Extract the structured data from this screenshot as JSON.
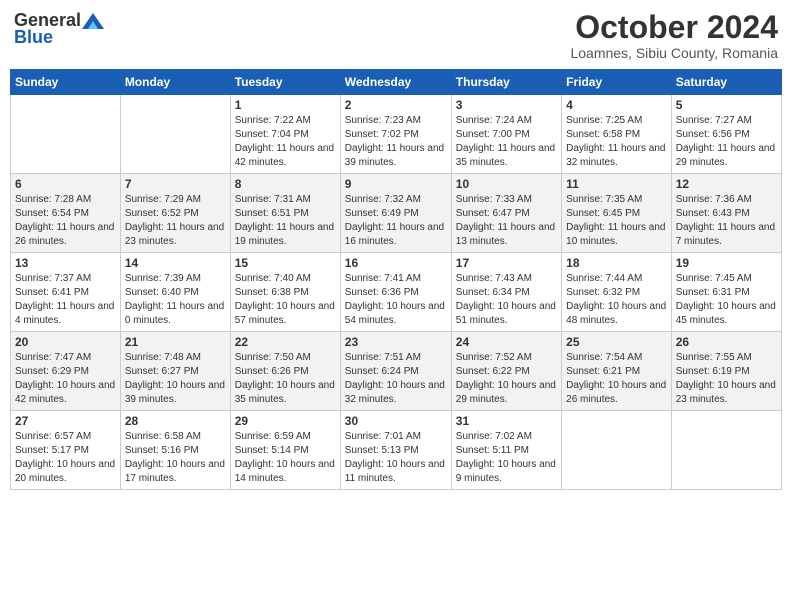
{
  "header": {
    "logo_general": "General",
    "logo_blue": "Blue",
    "month": "October 2024",
    "location": "Loamnes, Sibiu County, Romania"
  },
  "days_of_week": [
    "Sunday",
    "Monday",
    "Tuesday",
    "Wednesday",
    "Thursday",
    "Friday",
    "Saturday"
  ],
  "weeks": [
    [
      {
        "day": "",
        "detail": ""
      },
      {
        "day": "",
        "detail": ""
      },
      {
        "day": "1",
        "detail": "Sunrise: 7:22 AM\nSunset: 7:04 PM\nDaylight: 11 hours and 42 minutes."
      },
      {
        "day": "2",
        "detail": "Sunrise: 7:23 AM\nSunset: 7:02 PM\nDaylight: 11 hours and 39 minutes."
      },
      {
        "day": "3",
        "detail": "Sunrise: 7:24 AM\nSunset: 7:00 PM\nDaylight: 11 hours and 35 minutes."
      },
      {
        "day": "4",
        "detail": "Sunrise: 7:25 AM\nSunset: 6:58 PM\nDaylight: 11 hours and 32 minutes."
      },
      {
        "day": "5",
        "detail": "Sunrise: 7:27 AM\nSunset: 6:56 PM\nDaylight: 11 hours and 29 minutes."
      }
    ],
    [
      {
        "day": "6",
        "detail": "Sunrise: 7:28 AM\nSunset: 6:54 PM\nDaylight: 11 hours and 26 minutes."
      },
      {
        "day": "7",
        "detail": "Sunrise: 7:29 AM\nSunset: 6:52 PM\nDaylight: 11 hours and 23 minutes."
      },
      {
        "day": "8",
        "detail": "Sunrise: 7:31 AM\nSunset: 6:51 PM\nDaylight: 11 hours and 19 minutes."
      },
      {
        "day": "9",
        "detail": "Sunrise: 7:32 AM\nSunset: 6:49 PM\nDaylight: 11 hours and 16 minutes."
      },
      {
        "day": "10",
        "detail": "Sunrise: 7:33 AM\nSunset: 6:47 PM\nDaylight: 11 hours and 13 minutes."
      },
      {
        "day": "11",
        "detail": "Sunrise: 7:35 AM\nSunset: 6:45 PM\nDaylight: 11 hours and 10 minutes."
      },
      {
        "day": "12",
        "detail": "Sunrise: 7:36 AM\nSunset: 6:43 PM\nDaylight: 11 hours and 7 minutes."
      }
    ],
    [
      {
        "day": "13",
        "detail": "Sunrise: 7:37 AM\nSunset: 6:41 PM\nDaylight: 11 hours and 4 minutes."
      },
      {
        "day": "14",
        "detail": "Sunrise: 7:39 AM\nSunset: 6:40 PM\nDaylight: 11 hours and 0 minutes."
      },
      {
        "day": "15",
        "detail": "Sunrise: 7:40 AM\nSunset: 6:38 PM\nDaylight: 10 hours and 57 minutes."
      },
      {
        "day": "16",
        "detail": "Sunrise: 7:41 AM\nSunset: 6:36 PM\nDaylight: 10 hours and 54 minutes."
      },
      {
        "day": "17",
        "detail": "Sunrise: 7:43 AM\nSunset: 6:34 PM\nDaylight: 10 hours and 51 minutes."
      },
      {
        "day": "18",
        "detail": "Sunrise: 7:44 AM\nSunset: 6:32 PM\nDaylight: 10 hours and 48 minutes."
      },
      {
        "day": "19",
        "detail": "Sunrise: 7:45 AM\nSunset: 6:31 PM\nDaylight: 10 hours and 45 minutes."
      }
    ],
    [
      {
        "day": "20",
        "detail": "Sunrise: 7:47 AM\nSunset: 6:29 PM\nDaylight: 10 hours and 42 minutes."
      },
      {
        "day": "21",
        "detail": "Sunrise: 7:48 AM\nSunset: 6:27 PM\nDaylight: 10 hours and 39 minutes."
      },
      {
        "day": "22",
        "detail": "Sunrise: 7:50 AM\nSunset: 6:26 PM\nDaylight: 10 hours and 35 minutes."
      },
      {
        "day": "23",
        "detail": "Sunrise: 7:51 AM\nSunset: 6:24 PM\nDaylight: 10 hours and 32 minutes."
      },
      {
        "day": "24",
        "detail": "Sunrise: 7:52 AM\nSunset: 6:22 PM\nDaylight: 10 hours and 29 minutes."
      },
      {
        "day": "25",
        "detail": "Sunrise: 7:54 AM\nSunset: 6:21 PM\nDaylight: 10 hours and 26 minutes."
      },
      {
        "day": "26",
        "detail": "Sunrise: 7:55 AM\nSunset: 6:19 PM\nDaylight: 10 hours and 23 minutes."
      }
    ],
    [
      {
        "day": "27",
        "detail": "Sunrise: 6:57 AM\nSunset: 5:17 PM\nDaylight: 10 hours and 20 minutes."
      },
      {
        "day": "28",
        "detail": "Sunrise: 6:58 AM\nSunset: 5:16 PM\nDaylight: 10 hours and 17 minutes."
      },
      {
        "day": "29",
        "detail": "Sunrise: 6:59 AM\nSunset: 5:14 PM\nDaylight: 10 hours and 14 minutes."
      },
      {
        "day": "30",
        "detail": "Sunrise: 7:01 AM\nSunset: 5:13 PM\nDaylight: 10 hours and 11 minutes."
      },
      {
        "day": "31",
        "detail": "Sunrise: 7:02 AM\nSunset: 5:11 PM\nDaylight: 10 hours and 9 minutes."
      },
      {
        "day": "",
        "detail": ""
      },
      {
        "day": "",
        "detail": ""
      }
    ]
  ]
}
